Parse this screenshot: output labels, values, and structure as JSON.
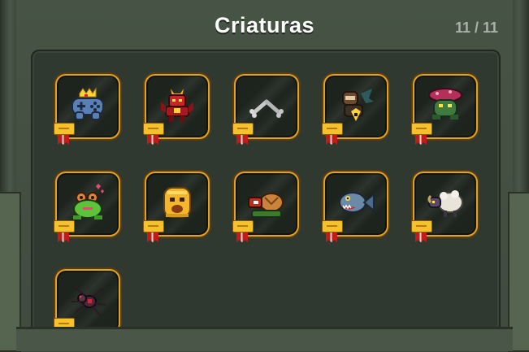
{
  "title": "Criaturas",
  "counter": "11 / 11",
  "creatures": [
    {
      "name": "crowned-gamepad",
      "icon": "gamepad-king-icon"
    },
    {
      "name": "red-demon",
      "icon": "demon-icon"
    },
    {
      "name": "bones",
      "icon": "bones-icon"
    },
    {
      "name": "mole-creature",
      "icon": "mole-icon"
    },
    {
      "name": "mushroom-toad",
      "icon": "mushroom-toad-icon"
    },
    {
      "name": "love-frog",
      "icon": "frog-icon"
    },
    {
      "name": "gold-blob",
      "icon": "gold-blob-icon"
    },
    {
      "name": "shell-turtle",
      "icon": "turtle-icon"
    },
    {
      "name": "piranha",
      "icon": "piranha-icon"
    },
    {
      "name": "sheep",
      "icon": "sheep-icon"
    },
    {
      "name": "spider",
      "icon": "spider-icon"
    }
  ],
  "colors": {
    "slot_border": "#e0a227",
    "badge": "#f6c22c",
    "ribbon": "#c21b1b"
  }
}
